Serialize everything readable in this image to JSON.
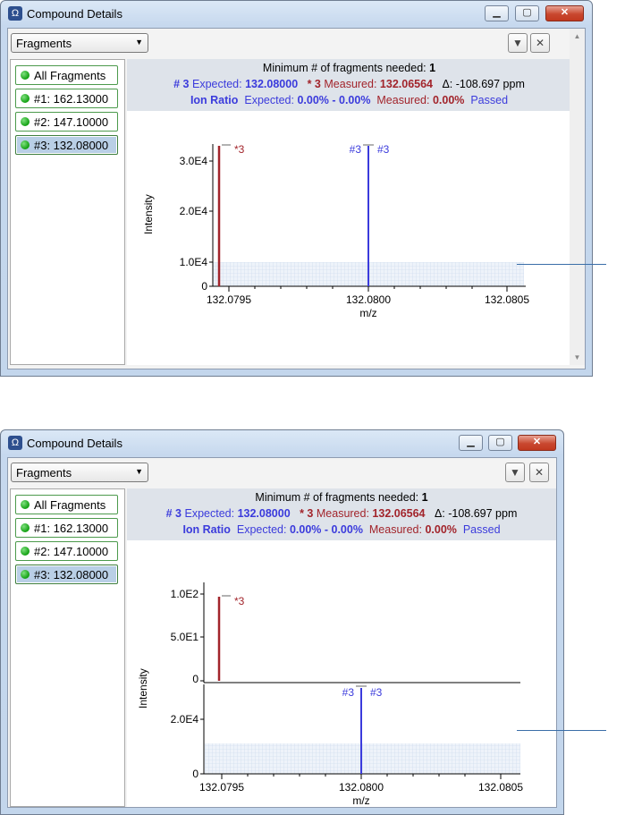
{
  "windows": [
    {
      "title": "Compound Details",
      "dropdown_value": "Fragments",
      "fragments": [
        "All Fragments",
        "#1: 162.13000",
        "#2: 147.10000",
        "#3: 132.08000"
      ],
      "info": {
        "min_label": "Minimum # of fragments needed:",
        "min_value": "1",
        "exp_hash": "# 3",
        "expected_label": "Expected:",
        "expected_value": "132.08000",
        "meas_hash": "* 3",
        "measured_label": "Measured:",
        "measured_value": "132.06564",
        "delta": "Δ: -108.697 ppm",
        "ion_ratio_label": "Ion Ratio",
        "ion_expected_label": "Expected:",
        "ion_expected_value": "0.00% - 0.00%",
        "ion_measured_label": "Measured:",
        "ion_measured_value": "0.00%",
        "status": "Passed"
      },
      "chart": {
        "ylabel": "Intensity",
        "xlabel": "m/z",
        "x_ticks": [
          "132.0795",
          "132.0800",
          "132.0805"
        ],
        "y_ticks": [
          "3.0E4",
          "2.0E4",
          "1.0E4",
          "0"
        ],
        "peak_labels": [
          "*3",
          "#3",
          "#3"
        ]
      }
    },
    {
      "title": "Compound Details",
      "dropdown_value": "Fragments",
      "fragments": [
        "All Fragments",
        "#1: 162.13000",
        "#2: 147.10000",
        "#3: 132.08000"
      ],
      "info": {
        "min_label": "Minimum # of fragments needed:",
        "min_value": "1",
        "exp_hash": "# 3",
        "expected_label": "Expected:",
        "expected_value": "132.08000",
        "meas_hash": "* 3",
        "measured_label": "Measured:",
        "measured_value": "132.06564",
        "delta": "Δ: -108.697 ppm",
        "ion_ratio_label": "Ion Ratio",
        "ion_expected_label": "Expected:",
        "ion_expected_value": "0.00% - 0.00%",
        "ion_measured_label": "Measured:",
        "ion_measured_value": "0.00%",
        "status": "Passed"
      },
      "chart": {
        "ylabel": "Intensity",
        "xlabel": "m/z",
        "x_ticks": [
          "132.0795",
          "132.0800",
          "132.0805"
        ],
        "top_y_ticks": [
          "1.0E2",
          "5.0E1",
          "0"
        ],
        "bottom_y_ticks": [
          "2.0E4",
          "0"
        ],
        "peak_labels": [
          "*3",
          "#3",
          "#3"
        ]
      }
    }
  ],
  "chart_data": [
    {
      "type": "bar",
      "xlabel": "m/z",
      "ylabel": "Intensity",
      "xlim": [
        132.0793,
        132.0807
      ],
      "ylim": [
        0,
        33000
      ],
      "series": [
        {
          "name": "*3",
          "color": "#a2242b",
          "x": [
            132.07935
          ],
          "values": [
            32500
          ]
        },
        {
          "name": "#3",
          "color": "#3b3bdc",
          "x": [
            132.08
          ],
          "values": [
            32500
          ]
        }
      ],
      "noise_band": [
        0,
        10000
      ]
    },
    {
      "type": "bar",
      "xlabel": "m/z",
      "ylabel": "Intensity",
      "xlim": [
        132.0793,
        132.0807
      ],
      "panels": [
        {
          "ylim": [
            0,
            105
          ],
          "series": [
            {
              "name": "*3",
              "color": "#a2242b",
              "x": [
                132.07935
              ],
              "values": [
                95
              ]
            }
          ]
        },
        {
          "ylim": [
            0,
            33000
          ],
          "series": [
            {
              "name": "#3",
              "color": "#3b3bdc",
              "x": [
                132.08
              ],
              "values": [
                32500
              ]
            }
          ],
          "noise_band": [
            0,
            10000
          ]
        }
      ]
    }
  ]
}
